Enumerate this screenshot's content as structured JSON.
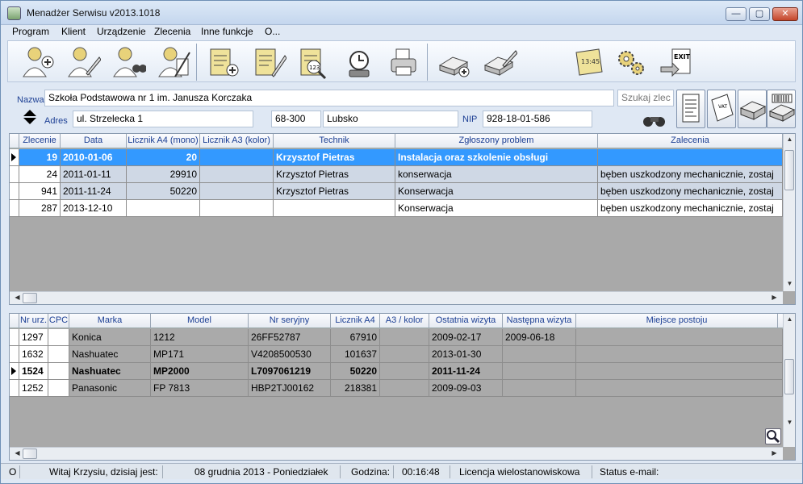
{
  "window": {
    "title": "Menadżer Serwisu v2013.1018"
  },
  "menu": [
    "Program",
    "Klient",
    "Urządzenie",
    "Zlecenia",
    "Inne funkcje",
    "O..."
  ],
  "client": {
    "name_label": "Nazwa",
    "name": "Szkoła Podstawowa nr 1 im. Janusza Korczaka",
    "search_placeholder": "Szukaj zlec",
    "address_label": "Adres",
    "address": "ul. Strzelecka 1",
    "postal": "68-300",
    "city": "Lubsko",
    "nip_label": "NIP",
    "nip": "928-18-01-586"
  },
  "orders": {
    "columns": [
      "Zlecenie",
      "Data",
      "Licznik A4 (mono)",
      "Licznik A3 (kolor)",
      "Technik",
      "Zgłoszony problem",
      "Zalecenia"
    ],
    "rows": [
      [
        "19",
        "2010-01-06",
        "20",
        "",
        "Krzysztof Pietras",
        "Instalacja oraz szkolenie obsługi",
        ""
      ],
      [
        "24",
        "2011-01-11",
        "29910",
        "",
        "Krzysztof Pietras",
        "konserwacja",
        "bęben uszkodzony mechanicznie, zostaj"
      ],
      [
        "941",
        "2011-11-24",
        "50220",
        "",
        "Krzysztof Pietras",
        "Konserwacja",
        "bęben uszkodzony mechanicznie, zostaj"
      ],
      [
        "287",
        "2013-12-10",
        "",
        "",
        "",
        "Konserwacja",
        "bęben uszkodzony mechanicznie, zostaj"
      ]
    ]
  },
  "devices": {
    "columns": [
      "Nr urz.",
      "CPC",
      "Marka",
      "Model",
      "Nr seryjny",
      "Licznik A4",
      "A3 / kolor",
      "Ostatnia wizyta",
      "Następna wizyta",
      "Miejsce postoju"
    ],
    "rows": [
      [
        "1297",
        "",
        "Konica",
        "1212",
        "26FF52787",
        "67910",
        "",
        "2009-02-17",
        "2009-06-18",
        ""
      ],
      [
        "1632",
        "",
        "Nashuatec",
        "MP171",
        "V4208500530",
        "101637",
        "",
        "2013-01-30",
        "",
        ""
      ],
      [
        "1524",
        "",
        "Nashuatec",
        "MP2000",
        "L7097061219",
        "50220",
        "",
        "2011-11-24",
        "",
        ""
      ],
      [
        "1252",
        "",
        "Panasonic",
        "FP 7813",
        "HBP2TJ00162",
        "218381",
        "",
        "2009-09-03",
        "",
        ""
      ]
    ]
  },
  "status": {
    "mode": "O",
    "greeting": "Witaj Krzysiu, dzisiaj jest:",
    "date": "08 grudnia 2013  -  Poniedziałek",
    "time_label": "Godzina:",
    "time": "00:16:48",
    "license": "Licencja wielostanowiskowa",
    "email": "Status e-mail:"
  },
  "colors": {
    "selected_row": "#3399ff",
    "blue_row": "#cfd8e5",
    "grid_bg": "#a9a9a9",
    "label_blue": "#1c3f94"
  },
  "toolbar_icons": [
    "add-client-icon",
    "edit-client-icon",
    "search-client-icon",
    "delete-client-icon",
    "add-device-icon",
    "edit-device-icon",
    "device-counter-icon",
    "service-visit-icon",
    "print-icon",
    "add-order-icon",
    "edit-order-icon",
    "notes-icon",
    "settings-icon",
    "exit-icon"
  ]
}
